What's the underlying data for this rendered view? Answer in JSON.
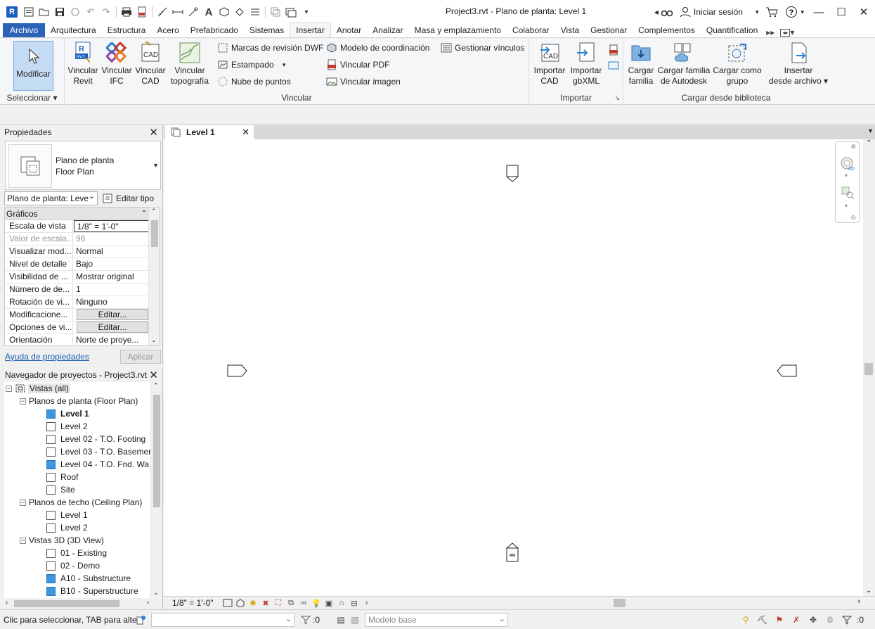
{
  "window": {
    "title": "Project3.rvt - Plano de planta: Level 1",
    "app_logo_letter": "R",
    "sign_in": "Iniciar sesión"
  },
  "ribbon_tabs": [
    "Archivo",
    "Arquitectura",
    "Estructura",
    "Acero",
    "Prefabricado",
    "Sistemas",
    "Insertar",
    "Anotar",
    "Analizar",
    "Masa y emplazamiento",
    "Colaborar",
    "Vista",
    "Gestionar",
    "Complementos",
    "Quantification"
  ],
  "active_tab": "Insertar",
  "ribbon": {
    "select": {
      "modify_label": "Modificar",
      "panel_label": "Seleccionar"
    },
    "link": {
      "panel_label": "Vincular",
      "link_revit_1": "Vincular",
      "link_revit_2": "Revit",
      "link_ifc_1": "Vincular",
      "link_ifc_2": "IFC",
      "link_cad_1": "Vincular",
      "link_cad_2": "CAD",
      "link_topo_1": "Vincular",
      "link_topo_2": "topografía",
      "dwf_markup": "Marcas de revisión DWF",
      "decal": "Estampado",
      "point_cloud": "Nube de puntos",
      "coord_model": "Modelo  de coordinación",
      "link_pdf": "Vincular  PDF",
      "link_image": "Vincular  imagen",
      "manage_links": "Gestionar vínculos"
    },
    "import": {
      "panel_label": "Importar",
      "import_cad_1": "Importar",
      "import_cad_2": "CAD",
      "import_gbxml_1": "Importar",
      "import_gbxml_2": "gbXML"
    },
    "library": {
      "panel_label": "Cargar desde biblioteca",
      "load_family_1": "Cargar",
      "load_family_2": "familia",
      "load_autodesk_1": "Cargar familia",
      "load_autodesk_2": "de Autodesk",
      "load_group_1": "Cargar como",
      "load_group_2": "grupo",
      "insert_file_1": "Insertar",
      "insert_file_2": "desde archivo"
    }
  },
  "properties": {
    "title": "Propiedades",
    "type_line1": "Plano de planta",
    "type_line2": "Floor Plan",
    "instance_selector": "Plano de planta: Leve",
    "edit_type": "Editar tipo",
    "group": "Gráficos",
    "rows": [
      {
        "key": "Escala de vista",
        "value": "1/8\" = 1'-0\""
      },
      {
        "key": "Valor de escala...",
        "value": "96"
      },
      {
        "key": "Visualizar mod...",
        "value": "Normal"
      },
      {
        "key": "Nivel de detalle",
        "value": "Bajo"
      },
      {
        "key": "Visibilidad de ...",
        "value": "Mostrar original"
      },
      {
        "key": "Número de de...",
        "value": "1"
      },
      {
        "key": "Rotación de vi...",
        "value": "Ninguno"
      },
      {
        "key": "Modificacione...",
        "value": "Editar..."
      },
      {
        "key": "Opciones de vi...",
        "value": "Editar..."
      },
      {
        "key": "Orientación",
        "value": "Norte de proye..."
      }
    ],
    "help_link": "Ayuda de propiedades",
    "apply": "Aplicar"
  },
  "browser": {
    "title": "Navegador de proyectos - Project3.rvt",
    "root": "Vistas (all)",
    "floor_plans": "Planos de planta (Floor Plan)",
    "floor_items": [
      "Level 1",
      "Level 2",
      "Level 02 - T.O. Footing",
      "Level 03 - T.O. Basemen",
      "Level 04 - T.O. Fnd. Wa",
      "Roof",
      "Site"
    ],
    "ceiling_plans": "Planos de techo (Ceiling Plan)",
    "ceiling_items": [
      "Level 1",
      "Level 2"
    ],
    "views_3d": "Vistas 3D (3D View)",
    "items_3d": [
      "01 - Existing",
      "02 - Demo",
      "A10 - Substructure",
      "B10 - Superstructure"
    ]
  },
  "view_tab": {
    "label": "Level 1"
  },
  "view_control": {
    "scale": "1/8\" = 1'-0\""
  },
  "statusbar": {
    "message": "Clic para seleccionar, TAB para alte",
    "selection_count": ":0",
    "design_option": "Modelo base",
    "filter_count": ":0"
  },
  "colors": {
    "accent": "#2b63b8",
    "selected_button": "#c5dcf5",
    "view_icon_blue": "#3d96e0"
  }
}
